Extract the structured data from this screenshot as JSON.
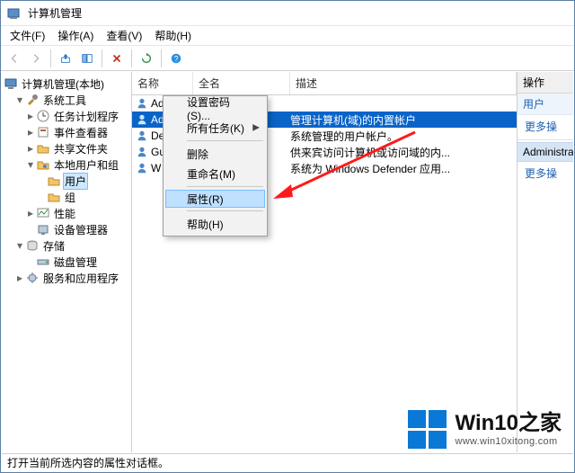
{
  "window": {
    "title": "计算机管理"
  },
  "menubar": {
    "file": "文件(F)",
    "action": "操作(A)",
    "view": "查看(V)",
    "help": "帮助(H)"
  },
  "tree": {
    "root": "计算机管理(本地)",
    "system_tools": "系统工具",
    "task_scheduler": "任务计划程序",
    "event_viewer": "事件查看器",
    "shared_folders": "共享文件夹",
    "local_users_groups": "本地用户和组",
    "users": "用户",
    "groups": "组",
    "performance": "性能",
    "device_manager": "设备管理器",
    "storage": "存储",
    "disk_mgmt": "磁盘管理",
    "services_apps": "服务和应用程序"
  },
  "list": {
    "columns": {
      "name": "名称",
      "fullname": "全名",
      "description": "描述"
    },
    "rows": [
      {
        "name": "Admin",
        "fullname": "",
        "description": ""
      },
      {
        "name": "Administrat",
        "fullname": "",
        "description": "管理计算机(域)的内置帐户"
      },
      {
        "name": "De",
        "fullname": "",
        "description": "系统管理的用户帐户。"
      },
      {
        "name": "Gu",
        "fullname": "",
        "description": "供来宾访问计算机或访问域的内..."
      },
      {
        "name": "W",
        "fullname": "",
        "description": "系统为 Windows Defender 应用..."
      }
    ]
  },
  "context_menu": {
    "set_password": "设置密码(S)...",
    "all_tasks": "所有任务(K)",
    "delete": "删除",
    "rename": "重命名(M)",
    "properties": "属性(R)",
    "help": "帮助(H)"
  },
  "actions_pane": {
    "header": "操作",
    "group": "用户",
    "more": "更多操",
    "selection": "Administrat",
    "more2": "更多操"
  },
  "statusbar": {
    "text": "打开当前所选内容的属性对话框。"
  },
  "watermark": {
    "title": "Win10之家",
    "url": "www.win10xitong.com"
  }
}
